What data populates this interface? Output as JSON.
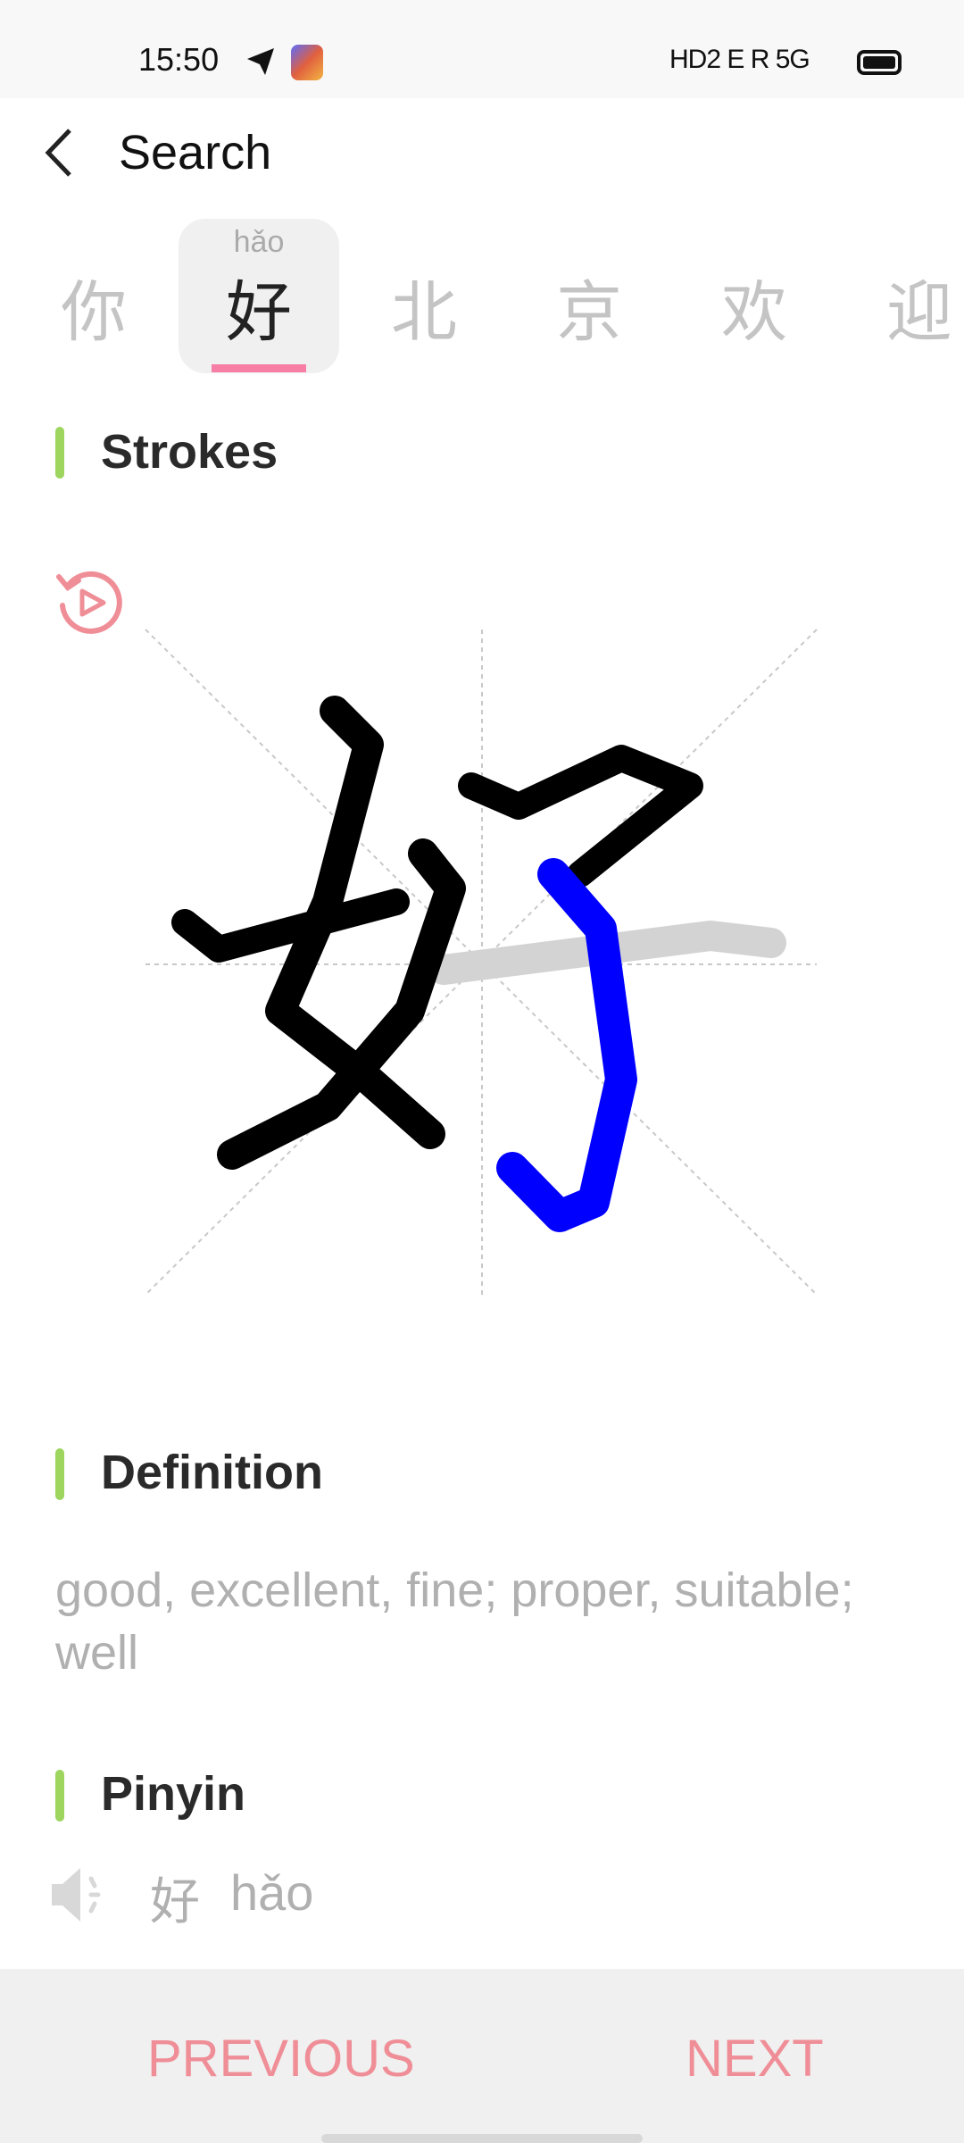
{
  "status_bar": {
    "time": "15:50",
    "network": "HD2 E R 5G"
  },
  "header": {
    "title": "Search"
  },
  "tabs": [
    {
      "char": "你",
      "selected": false
    },
    {
      "char": "好",
      "pinyin": "hǎo",
      "selected": true
    },
    {
      "char": "北",
      "selected": false
    },
    {
      "char": "京",
      "selected": false
    },
    {
      "char": "欢",
      "selected": false
    },
    {
      "char": "迎",
      "selected": false
    }
  ],
  "strokes": {
    "title": "Strokes",
    "character": "好",
    "current_stroke_color": "#0000ff",
    "done_color": "#000000",
    "pending_color": "#d3d3d3"
  },
  "definition": {
    "title": "Definition",
    "text": "good, excellent, fine; proper, suitable; well"
  },
  "pinyin": {
    "title": "Pinyin",
    "char": "好",
    "reading": "hǎo"
  },
  "footer": {
    "previous": "PREVIOUS",
    "next": "NEXT"
  },
  "colors": {
    "accent": "#ef8e97",
    "section_bar": "#9dd55f",
    "underline": "#f77fa6"
  }
}
